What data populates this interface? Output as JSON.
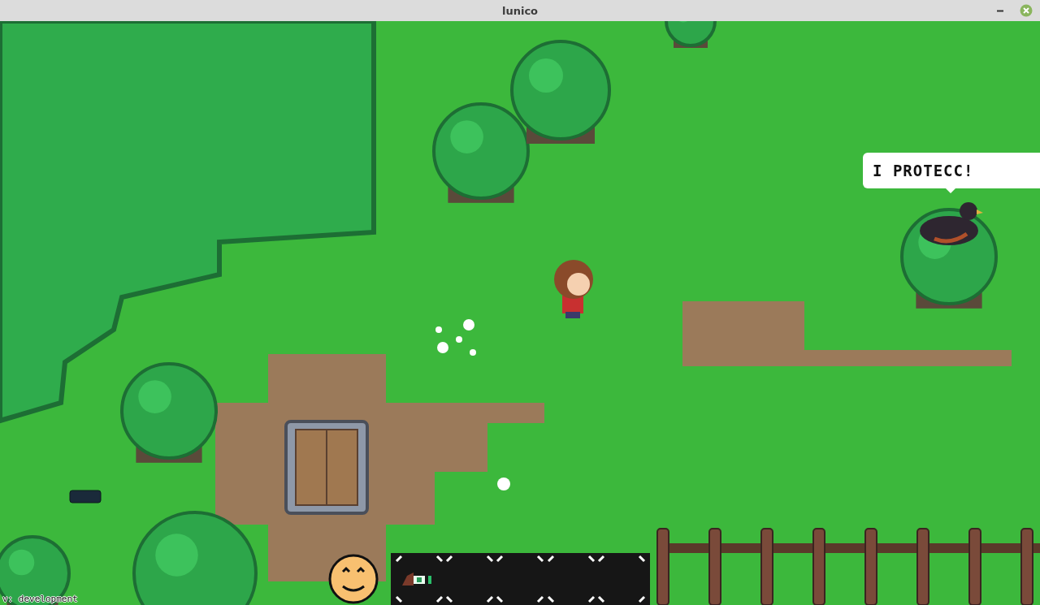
{
  "window": {
    "title": "lunico"
  },
  "speech_bubble": {
    "text": "I PROTECC!"
  },
  "hotbar": {
    "slots": [
      {
        "kind": "item"
      },
      {
        "kind": "empty"
      },
      {
        "kind": "empty"
      },
      {
        "kind": "empty"
      },
      {
        "kind": "empty"
      }
    ]
  },
  "version": "v: development"
}
